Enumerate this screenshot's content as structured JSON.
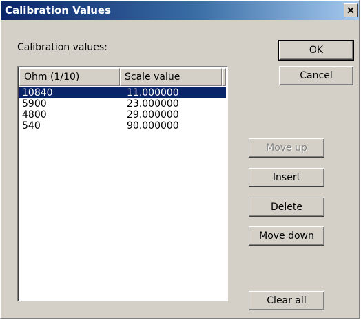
{
  "window": {
    "title": "Calibration Values",
    "close_glyph": "✕"
  },
  "label": "Calibration values:",
  "table": {
    "columns": [
      "Ohm (1/10)",
      "Scale value"
    ],
    "rows": [
      {
        "ohm": "10840",
        "scale": "11.000000",
        "selected": true
      },
      {
        "ohm": "5900",
        "scale": "23.000000",
        "selected": false
      },
      {
        "ohm": "4800",
        "scale": "29.000000",
        "selected": false
      },
      {
        "ohm": "540",
        "scale": "90.000000",
        "selected": false
      }
    ]
  },
  "buttons": {
    "ok": "OK",
    "cancel": "Cancel",
    "move_up": "Move up",
    "insert": "Insert",
    "delete": "Delete",
    "move_down": "Move down",
    "clear_all": "Clear all"
  },
  "colors": {
    "selection": "#0a246a",
    "face": "#d4d0c8"
  }
}
